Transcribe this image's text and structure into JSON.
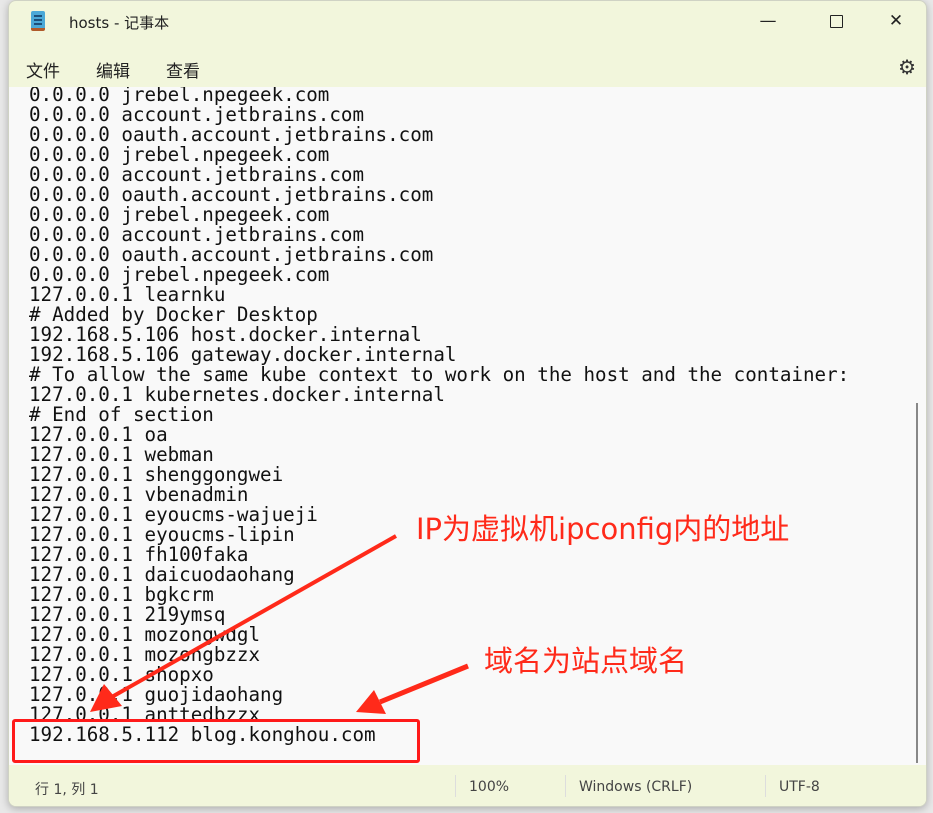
{
  "window": {
    "title": "hosts - 记事本",
    "controls": [
      "minimize",
      "maximize",
      "close"
    ]
  },
  "menu": {
    "items": [
      "文件",
      "编辑",
      "查看"
    ],
    "settings_icon": "gear-icon"
  },
  "editor": {
    "lines": [
      "0.0.0.0 jrebel.npegeek.com",
      "0.0.0.0 account.jetbrains.com",
      "0.0.0.0 oauth.account.jetbrains.com",
      "0.0.0.0 jrebel.npegeek.com",
      "0.0.0.0 account.jetbrains.com",
      "0.0.0.0 oauth.account.jetbrains.com",
      "0.0.0.0 jrebel.npegeek.com",
      "0.0.0.0 account.jetbrains.com",
      "0.0.0.0 oauth.account.jetbrains.com",
      "0.0.0.0 jrebel.npegeek.com",
      "127.0.0.1 learnku",
      "# Added by Docker Desktop",
      "192.168.5.106 host.docker.internal",
      "192.168.5.106 gateway.docker.internal",
      "# To allow the same kube context to work on the host and the container:",
      "127.0.0.1 kubernetes.docker.internal",
      "# End of section",
      "127.0.0.1 oa",
      "127.0.0.1 webman",
      "127.0.0.1 shenggongwei",
      "127.0.0.1 vbenadmin",
      "127.0.0.1 eyoucms-wajueji",
      "127.0.0.1 eyoucms-lipin",
      "127.0.0.1 fh100faka",
      "127.0.0.1 daicuodaohang",
      "127.0.0.1 bgkcrm",
      "127.0.0.1 219ymsq",
      "127.0.0.1 mozongwdgl",
      "127.0.0.1 mozongbzzx",
      "127.0.0.1 shopxo",
      "127.0.0.1 guojidaohang",
      "127.0.0.1 anttedbzzx",
      "192.168.5.112 blog.konghou.com"
    ]
  },
  "status": {
    "position": "行 1, 列 1",
    "zoom": "100%",
    "line_ending": "Windows (CRLF)",
    "encoding": "UTF-8"
  },
  "annotations": {
    "ip_note": "IP为虚拟机ipconfig内的地址",
    "domain_note": "域名为站点域名",
    "color": "#ff2a1a"
  }
}
